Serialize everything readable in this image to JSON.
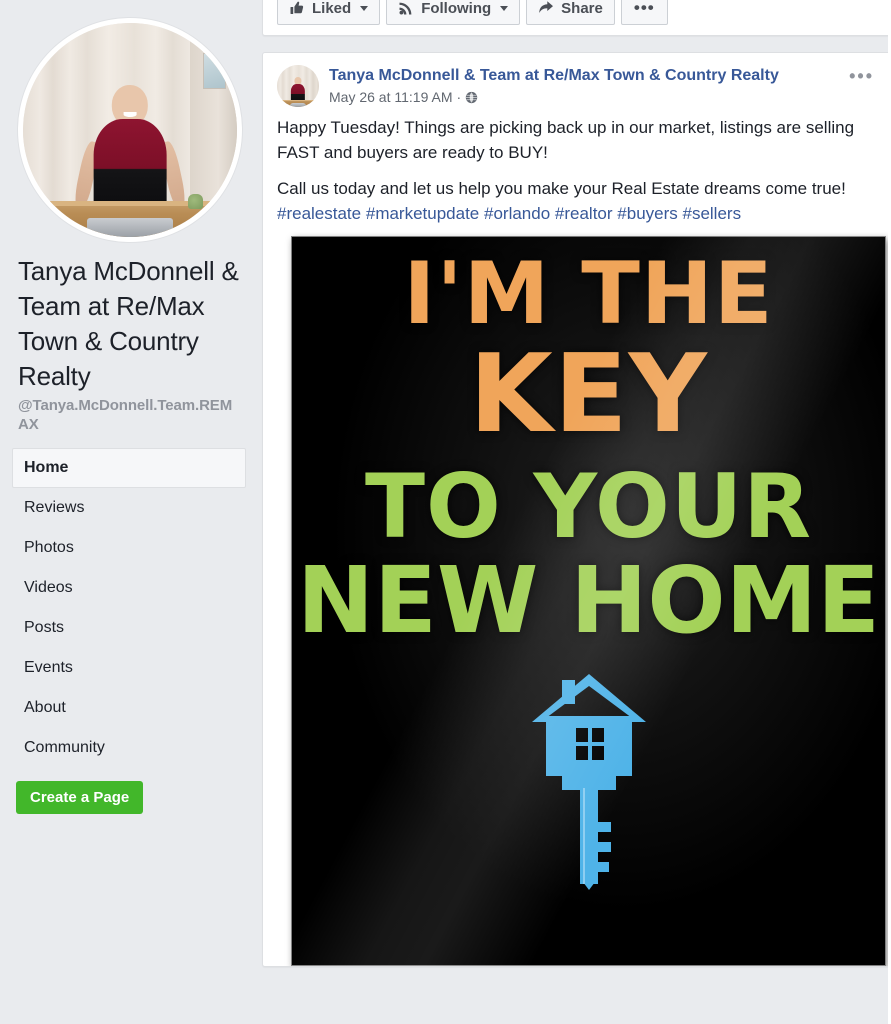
{
  "sidebar": {
    "profile_photo_alt": "Smiling woman in burgundy top standing behind a wooden desk with a laptop",
    "page_title": "Tanya McDonnell & Team at Re/Max Town & Country Realty",
    "page_handle": "@Tanya.McDonnell.Team.REMAX",
    "nav_items": [
      {
        "label": "Home",
        "active": true
      },
      {
        "label": "Reviews",
        "active": false
      },
      {
        "label": "Photos",
        "active": false
      },
      {
        "label": "Videos",
        "active": false
      },
      {
        "label": "Posts",
        "active": false
      },
      {
        "label": "Events",
        "active": false
      },
      {
        "label": "About",
        "active": false
      },
      {
        "label": "Community",
        "active": false
      }
    ],
    "create_page_label": "Create a Page",
    "create_page_color": "#42b72a"
  },
  "action_bar": {
    "liked_label": "Liked",
    "following_label": "Following",
    "share_label": "Share",
    "more_label": "•••"
  },
  "post": {
    "author": "Tanya McDonnell & Team at Re/Max Town & Country Realty",
    "author_color": "#385898",
    "timestamp": "May 26 at 11:19 AM",
    "privacy_separator": "·",
    "privacy_icon": "globe-icon",
    "menu_label": "•••",
    "paragraph_1": "Happy Tuesday! Things are picking back up in our market, listings are selling FAST and buyers are ready to BUY!",
    "paragraph_2_prefix": "Call us today and let us help you make your Real Estate dreams come true! ",
    "hashtags": [
      "#realestate",
      "#marketupdate",
      "#orlando",
      "#realtor",
      "#buyers",
      "#sellers"
    ],
    "hashtag_color": "#385898",
    "photo": {
      "alt": "Chalkboard sign reading I'M THE KEY TO YOUR NEW HOME with a blue house-shaped key",
      "background_color": "#000000",
      "line_1": "I'M THE",
      "line_2": "KEY",
      "line_3": "TO YOUR",
      "line_4": "NEW HOME",
      "line_1_color": "#f0a55a",
      "line_2_color": "#f0a55a",
      "line_3_color": "#a3d157",
      "line_4_color": "#a3d157",
      "key_icon_color": "#4fb3e8",
      "key_icon_name": "house-key-icon"
    }
  }
}
